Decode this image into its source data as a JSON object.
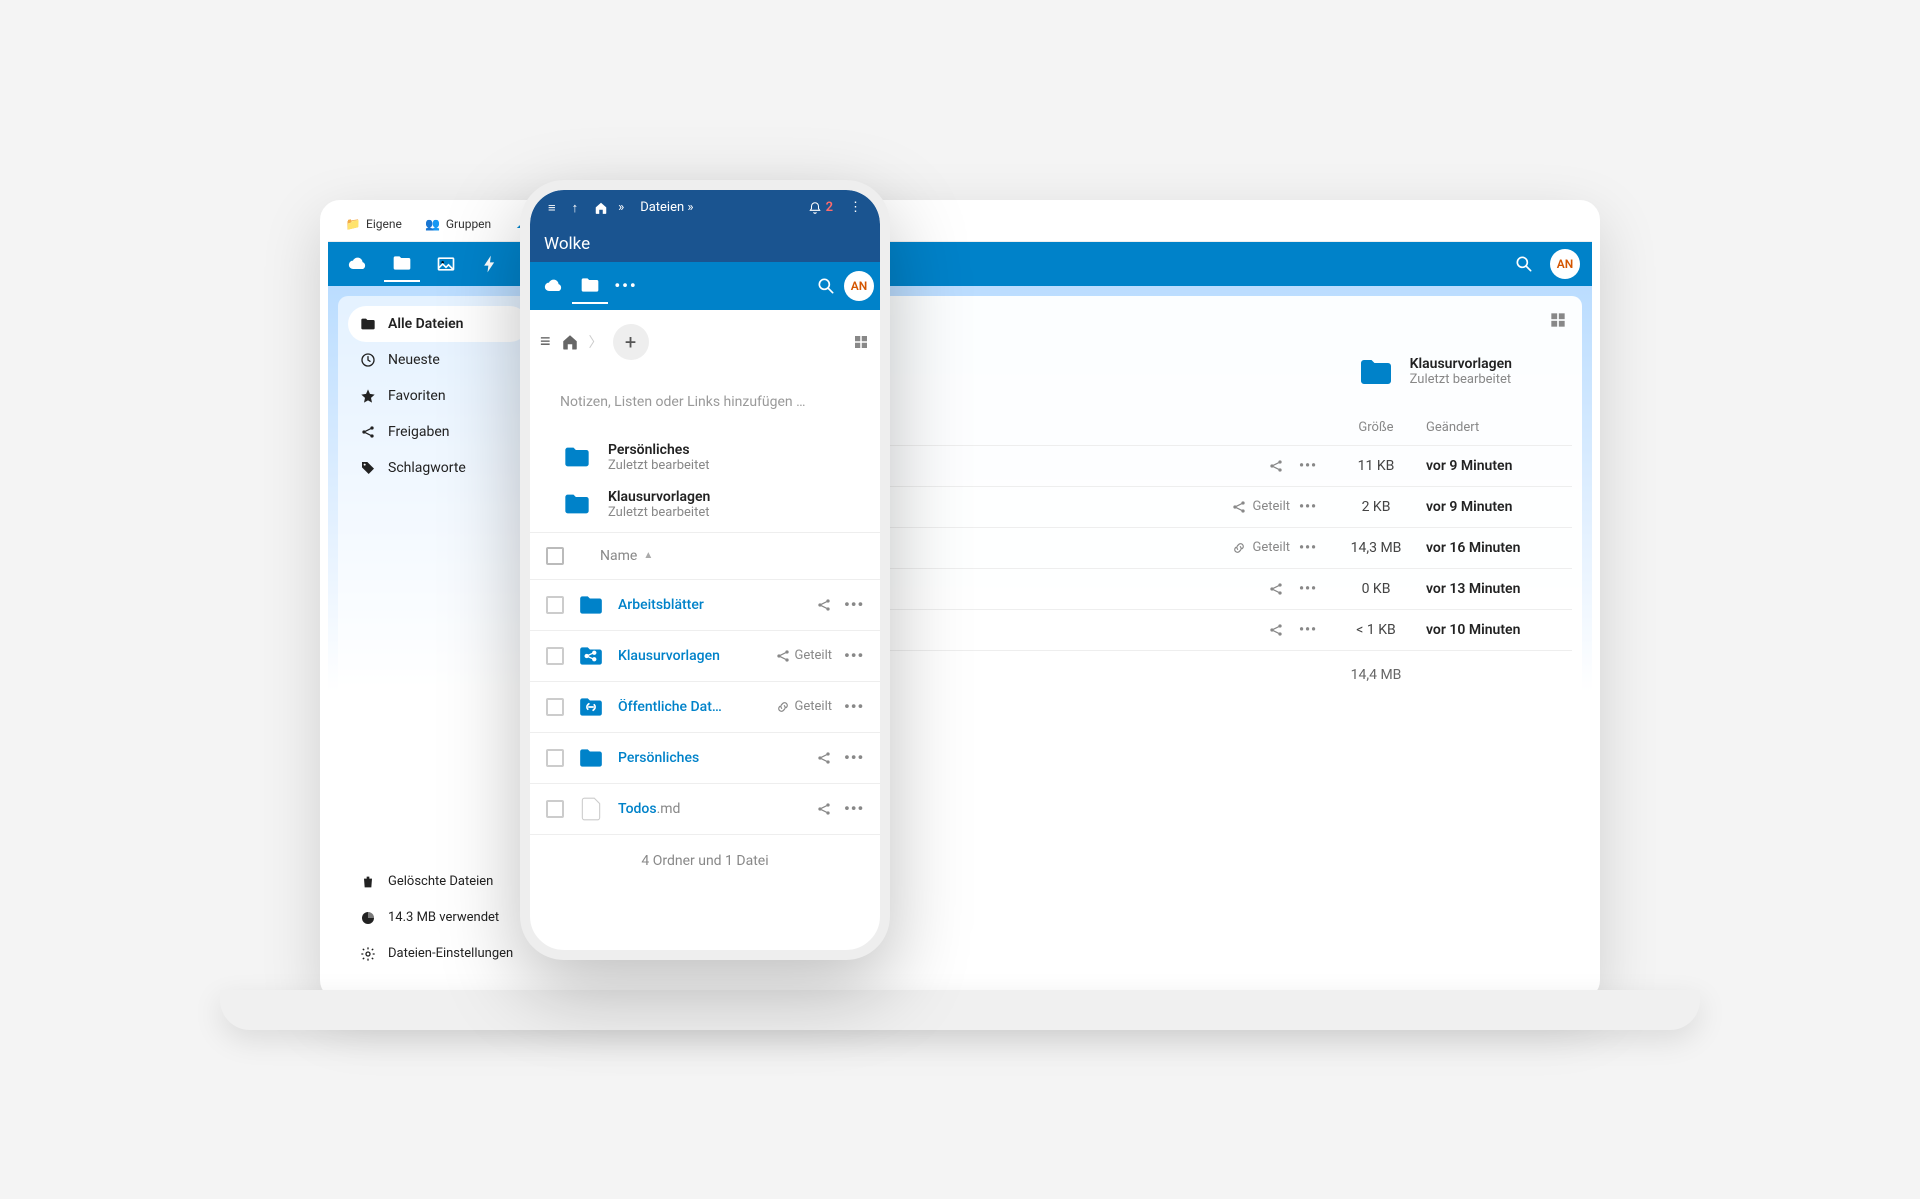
{
  "browser_tabs": [
    {
      "icon": "📁",
      "label": "Eigene"
    },
    {
      "icon": "👥",
      "label": "Gruppen"
    },
    {
      "icon": "☁️",
      "label": ""
    }
  ],
  "avatar": "AN",
  "sidebar": {
    "items": [
      {
        "label": "Alle Dateien"
      },
      {
        "label": "Neueste"
      },
      {
        "label": "Favoriten"
      },
      {
        "label": "Freigaben"
      },
      {
        "label": "Schlagworte"
      }
    ],
    "trash": "Gelöschte Dateien",
    "usage": "14.3 MB verwendet",
    "settings": "Dateien-Einstellungen"
  },
  "recent": [
    {
      "title": "Klausurvorlagen",
      "sub": "Zuletzt bearbeitet"
    }
  ],
  "table": {
    "headers": {
      "size": "Größe",
      "modified": "Geändert"
    },
    "rows": [
      {
        "share": "",
        "share_icon": "share",
        "size": "11 KB",
        "mod": "vor 9 Minuten"
      },
      {
        "share": "Geteilt",
        "share_icon": "share",
        "size": "2 KB",
        "mod": "vor 9 Minuten"
      },
      {
        "share": "Geteilt",
        "share_icon": "link",
        "size": "14,3 MB",
        "mod": "vor 16 Minuten"
      },
      {
        "share": "",
        "share_icon": "share",
        "size": "0 KB",
        "mod": "vor 13 Minuten"
      },
      {
        "share": "",
        "share_icon": "share",
        "size": "< 1 KB",
        "mod": "vor 10 Minuten"
      }
    ],
    "summary_size": "14,4 MB"
  },
  "phone": {
    "status": {
      "breadcrumb": "Dateien »",
      "notif_count": "2"
    },
    "title": "Wolke",
    "note": "Notizen, Listen oder Links hinzufügen …",
    "recent": [
      {
        "title": "Persönliches",
        "sub": "Zuletzt bearbeitet"
      },
      {
        "title": "Klausurvorlagen",
        "sub": "Zuletzt bearbeitet"
      }
    ],
    "thead": {
      "name": "Name"
    },
    "rows": [
      {
        "type": "folder",
        "name": "Arbeitsblätter",
        "share": "",
        "share_icon": "share"
      },
      {
        "type": "folder-share",
        "name": "Klausurvorlagen",
        "share": "Geteilt",
        "share_icon": "share"
      },
      {
        "type": "folder-link",
        "name": "Öffentliche Dat…",
        "share": "Geteilt",
        "share_icon": "link"
      },
      {
        "type": "folder",
        "name": "Persönliches",
        "share": "",
        "share_icon": "share"
      },
      {
        "type": "file",
        "name": "Todos",
        "ext": ".md",
        "share": "",
        "share_icon": "share"
      }
    ],
    "summary": "4 Ordner und 1 Datei"
  }
}
